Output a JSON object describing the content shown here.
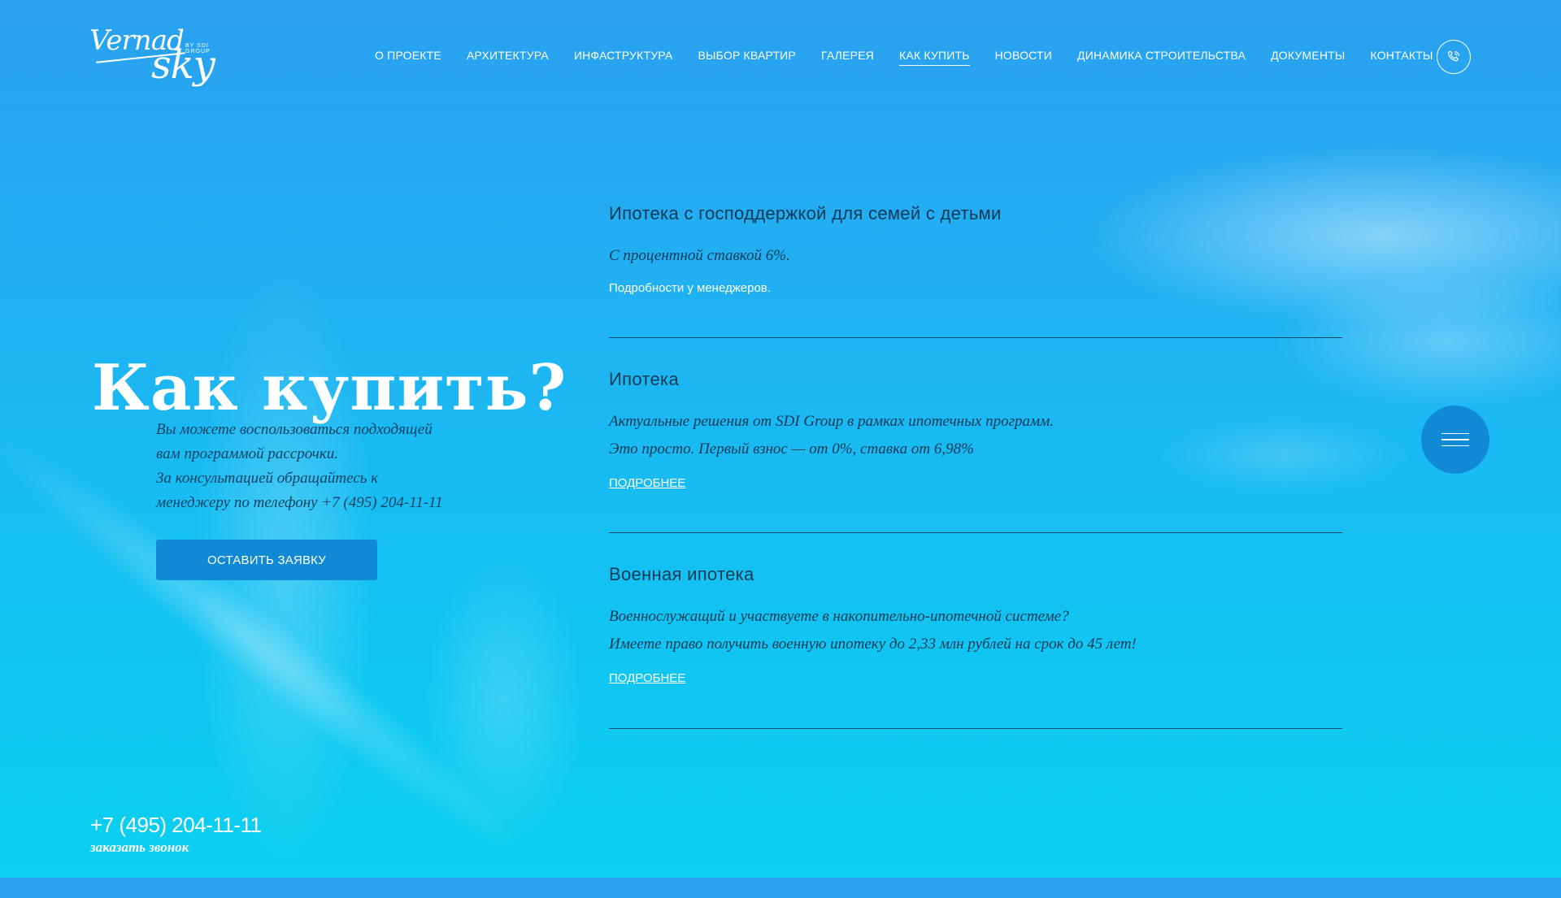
{
  "logo": {
    "word1": "Vernad",
    "word2": "sky",
    "tag": "BY SDI GROUP"
  },
  "nav": [
    {
      "label": "О ПРОЕКТЕ"
    },
    {
      "label": "АРХИТЕКТУРА"
    },
    {
      "label": "ИНФАСТРУКТУРА"
    },
    {
      "label": "ВЫБОР КВАРТИР"
    },
    {
      "label": "ГАЛЕРЕЯ"
    },
    {
      "label": "КАК КУПИТЬ",
      "active": true
    },
    {
      "label": "НОВОСТИ"
    },
    {
      "label": "ДИНАМИКА СТРОИТЕЛЬСТВА"
    },
    {
      "label": "ДОКУМЕНТЫ"
    },
    {
      "label": "КОНТАКТЫ"
    }
  ],
  "hero": {
    "title": "Как купить?",
    "intro_lines": [
      "Вы можете воспользоваться подходящей",
      "вам программой рассрочки.",
      "За консультацией обращайтесь к",
      "менеджеру по телефону +7 (495) 204-11-11"
    ],
    "cta": "ОСТАВИТЬ ЗАЯВКУ"
  },
  "programs": [
    {
      "title": "Ипотека с господдержкой для семей с детьми",
      "lines": [
        "С процентной ставкой 6%."
      ],
      "note": "Подробности у менеджеров."
    },
    {
      "title": "Ипотека",
      "lines": [
        "Актуальные решения от SDI Group в рамках ипотечных программ.",
        "Это просто. Первый взнос — от 0%, ставка от 6,98%"
      ],
      "more": "ПОДРОБНЕЕ"
    },
    {
      "title": "Военная ипотека",
      "lines": [
        "Военнослужащий и участвуете в накопительно-ипотечной системе?",
        "Имеете право получить военную ипотеку до 2,33 млн рублей на срок до 45 лет!"
      ],
      "more": "ПОДРОБНЕЕ"
    }
  ],
  "footer": {
    "phone": "+7 (495) 204-11-11",
    "callback": "заказать звонок"
  },
  "icons": {
    "phone": "phone-icon",
    "menu": "menu-icon"
  },
  "colors": {
    "accent": "#118ad6",
    "text_dark": "#0d3a55"
  }
}
